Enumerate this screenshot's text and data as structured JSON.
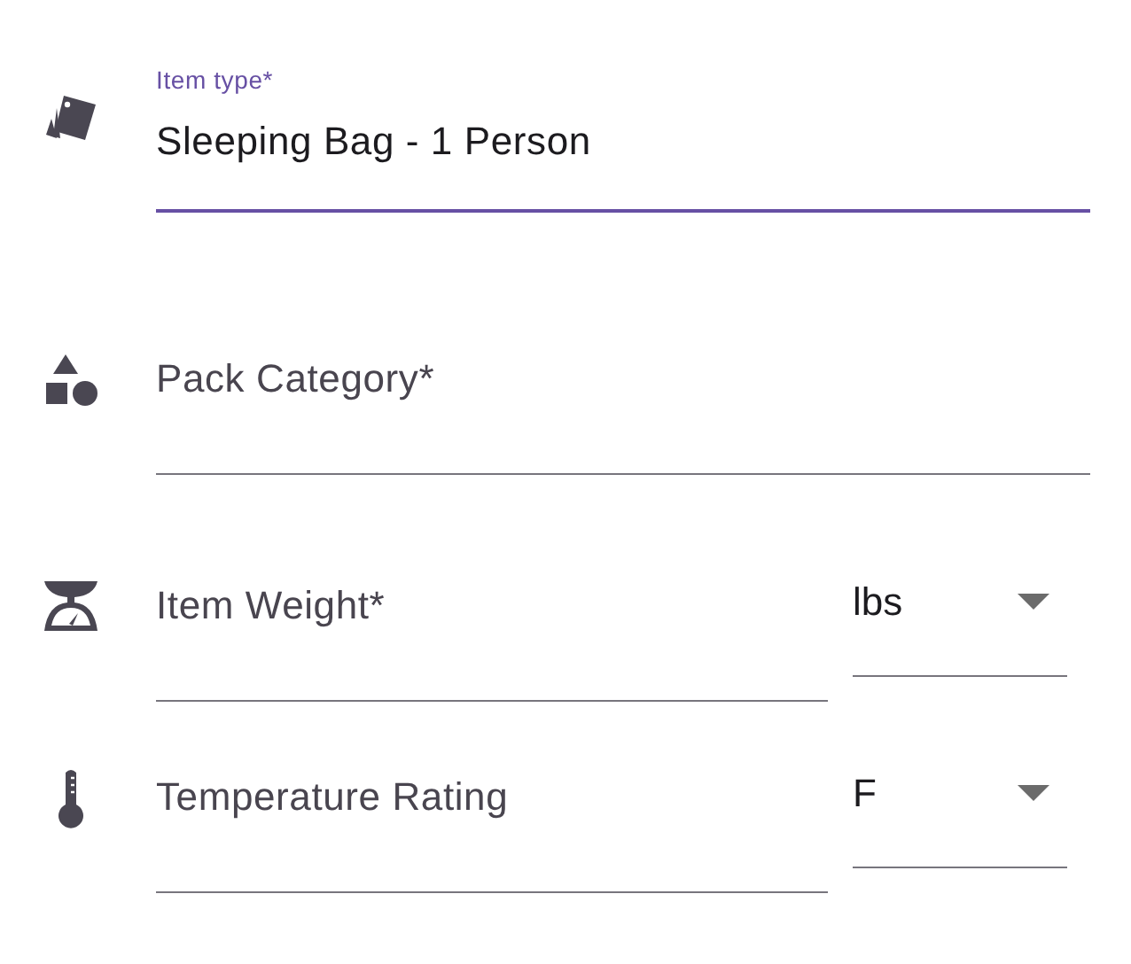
{
  "fields": [
    {
      "kind": "text",
      "label": "Item type*",
      "value": "Sleeping Bag - 1 Person",
      "focused": true
    },
    {
      "kind": "text",
      "label": "Pack Category*",
      "focused": false
    },
    {
      "kind": "with_unit",
      "label": "Item Weight*",
      "focused": false,
      "unit": "lbs"
    },
    {
      "kind": "with_unit",
      "label": "Temperature Rating",
      "focused": false,
      "unit": "F"
    }
  ]
}
